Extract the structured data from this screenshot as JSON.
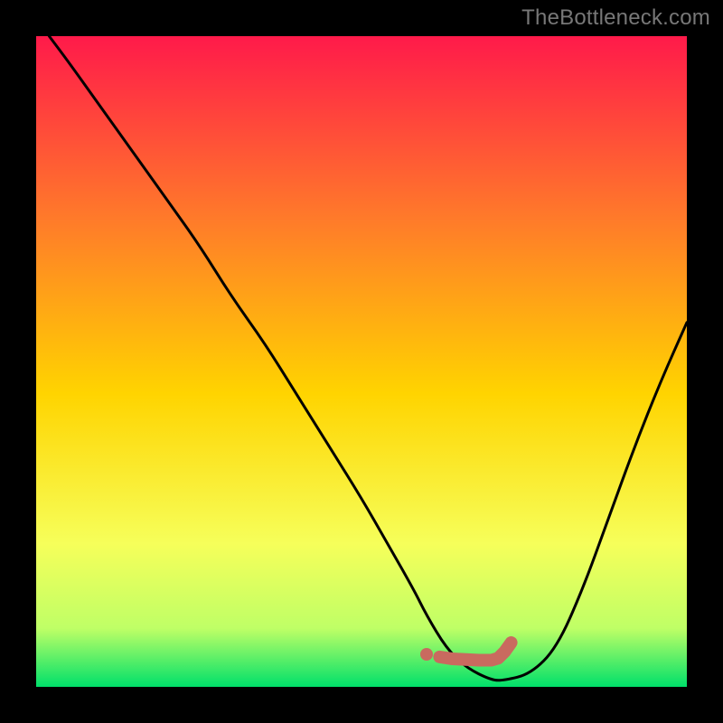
{
  "watermark": "TheBottleneck.com",
  "colors": {
    "frame": "#000000",
    "gradient_top": "#ff1a4a",
    "gradient_mid_upper": "#ff7a2a",
    "gradient_mid": "#ffd400",
    "gradient_lower": "#f6ff5a",
    "gradient_bottom_band": "#bfff66",
    "gradient_bottom": "#00e06a",
    "curve": "#000000",
    "marker_stroke": "#c96a5f",
    "marker_fill": "#c96a5f"
  },
  "chart_data": {
    "type": "line",
    "title": "",
    "xlabel": "",
    "ylabel": "",
    "xlim": [
      0,
      100
    ],
    "ylim": [
      0,
      100
    ],
    "series": [
      {
        "name": "bottleneck-curve",
        "x": [
          2,
          5,
          10,
          15,
          20,
          25,
          30,
          35,
          40,
          45,
          50,
          54,
          58,
          60,
          63,
          66,
          70,
          72,
          76,
          80,
          84,
          88,
          92,
          96,
          100
        ],
        "y": [
          100,
          96,
          89,
          82,
          75,
          68,
          60,
          53,
          45,
          37,
          29,
          22,
          15,
          11,
          6,
          3,
          1,
          1,
          2,
          6,
          15,
          26,
          37,
          47,
          56
        ]
      }
    ],
    "markers": {
      "name": "optimal-region",
      "x": [
        60,
        62,
        64,
        66,
        68,
        70,
        71,
        72,
        73
      ],
      "y": [
        5,
        4.6,
        4.3,
        4.2,
        4.1,
        4.1,
        4.4,
        5.4,
        6.8
      ]
    }
  }
}
